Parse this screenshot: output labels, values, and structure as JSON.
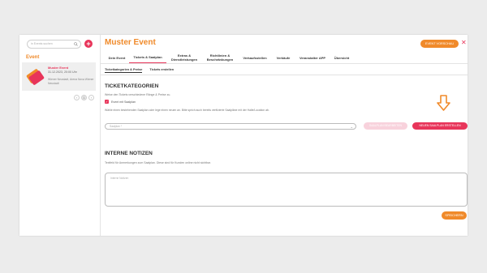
{
  "sidebar": {
    "search_placeholder": "in Events suchen",
    "add_label": "+",
    "section_label": "Event",
    "event": {
      "name": "Muster Event",
      "date": "31.12.2023, 20:00 Uhr",
      "venue": "Wiener Neustadt, Arena Nova Wiener Neustadt"
    },
    "pager": {
      "prev": "‹",
      "current": "1",
      "next": "›"
    }
  },
  "header": {
    "title": "Muster Event",
    "preview_label": "EVENT VORSCHAU",
    "close_label": "✕"
  },
  "tabs": [
    {
      "label": "Dein Event"
    },
    {
      "label": "Tickets & Saalplan"
    },
    {
      "label": "Extras & Dienstleistungen"
    },
    {
      "label": "Richtlinien & Beschränkungen"
    },
    {
      "label": "Verkaufsstellen"
    },
    {
      "label": "Verkäufe"
    },
    {
      "label": "Veranstalter APP"
    },
    {
      "label": "Übersicht"
    }
  ],
  "subtabs": [
    {
      "label": "Ticketkategorien & Preise"
    },
    {
      "label": "Tickets erstellen"
    }
  ],
  "tickets": {
    "heading": "TICKETKATEGORIEN",
    "description": "Weise den Tickets verschiedene Ränge & Preise zu.",
    "checkbox_label": "Event mit Saalplan",
    "checkbox_checked": true,
    "hint": "Wähle einen bestehenden Saalplan oder lege einen neuen an. Bitte sprich auch bereits verifizierte Saalpläne mit der Halle/Location ab.",
    "select_placeholder": "Saalplan *",
    "btn_disabled_label": "SAALPLAN BEARBEITEN",
    "btn_new_label": "NEUEN SAALPLAN ERSTELLEN"
  },
  "notes": {
    "heading": "INTERNE NOTIZEN",
    "description": "Textfeld für Anmerkungen zum Saalplan. Diese sind für Kunden online nicht sichtbar.",
    "placeholder": "Interne Notizen",
    "save_label": "SPEICHERN"
  },
  "colors": {
    "accent_orange": "#f08a2a",
    "accent_pink": "#e8355a"
  }
}
